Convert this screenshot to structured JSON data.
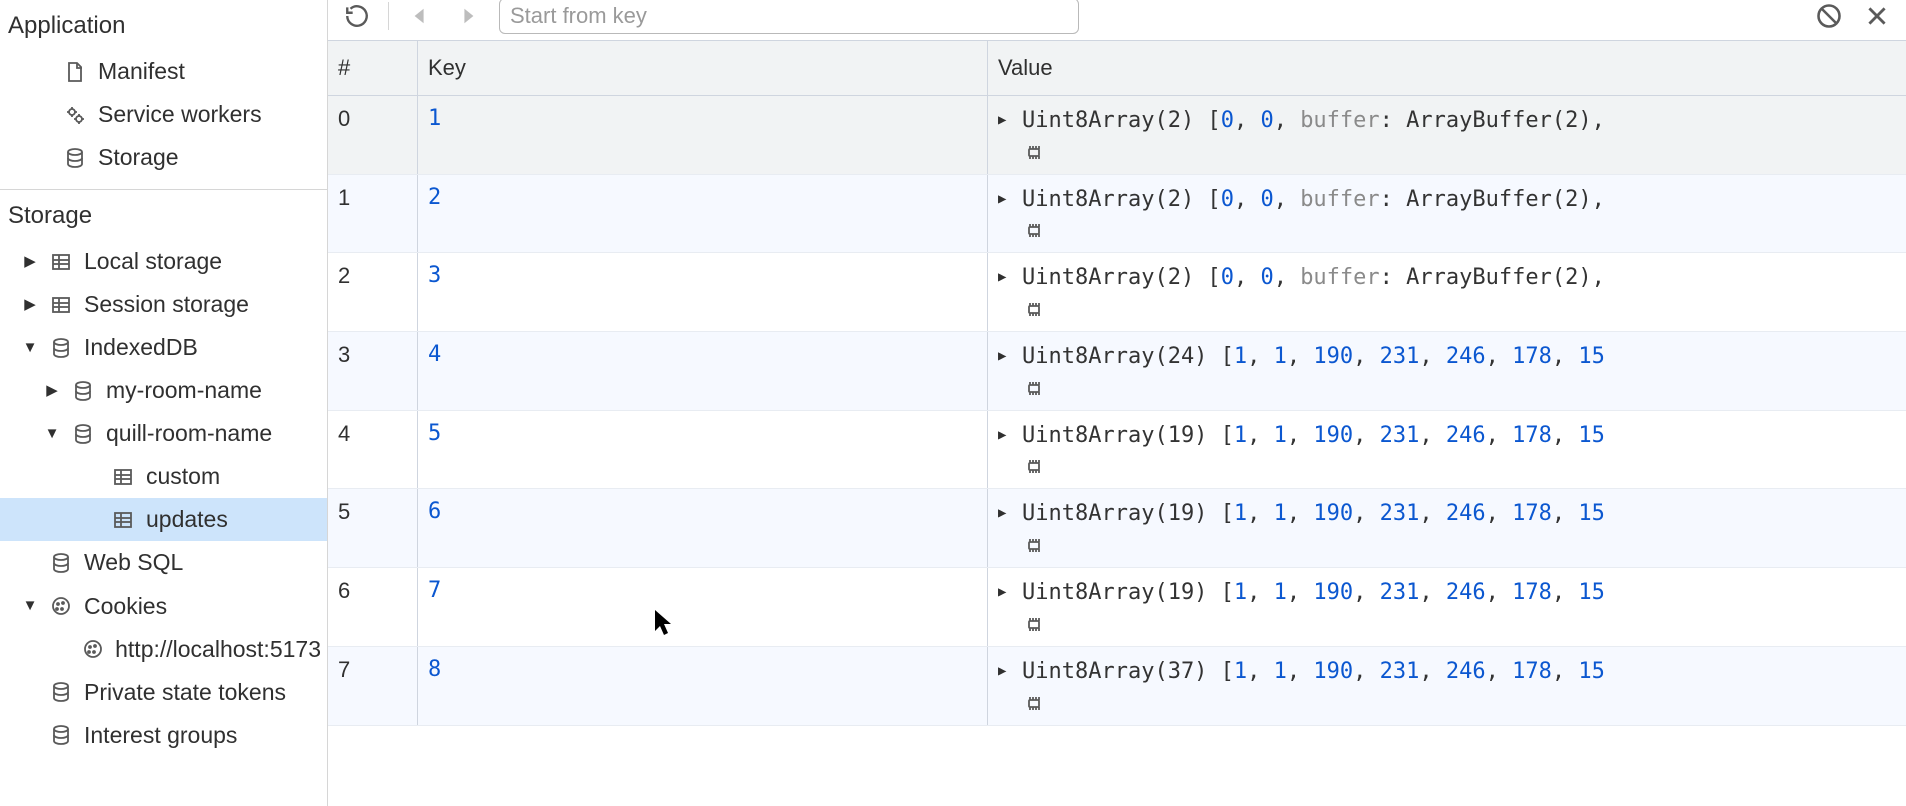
{
  "search": {
    "placeholder": "Start from key",
    "value": ""
  },
  "sidebar": {
    "section_application": "Application",
    "section_storage": "Storage",
    "items_app": [
      {
        "label": "Manifest",
        "icon": "file"
      },
      {
        "label": "Service workers",
        "icon": "gears"
      },
      {
        "label": "Storage",
        "icon": "db"
      }
    ],
    "items_storage": [
      {
        "label": "Local storage",
        "icon": "table",
        "expand": "right",
        "indent": 1
      },
      {
        "label": "Session storage",
        "icon": "table",
        "expand": "right",
        "indent": 1
      },
      {
        "label": "IndexedDB",
        "icon": "db",
        "expand": "down",
        "indent": 1
      },
      {
        "label": "my-room-name",
        "icon": "db",
        "expand": "right",
        "indent": 2
      },
      {
        "label": "quill-room-name",
        "icon": "db",
        "expand": "down",
        "indent": 2
      },
      {
        "label": "custom",
        "icon": "table",
        "expand": "none",
        "indent": 4
      },
      {
        "label": "updates",
        "icon": "table",
        "expand": "none",
        "indent": 4,
        "selected": true
      },
      {
        "label": "Web SQL",
        "icon": "db",
        "expand": "none",
        "indent": 1
      },
      {
        "label": "Cookies",
        "icon": "cookie",
        "expand": "down",
        "indent": 1
      },
      {
        "label": "http://localhost:5173",
        "icon": "cookie",
        "expand": "none",
        "indent": 3
      },
      {
        "label": "Private state tokens",
        "icon": "db",
        "expand": "none",
        "indent": 1
      },
      {
        "label": "Interest groups",
        "icon": "db",
        "expand": "none",
        "indent": 1
      }
    ]
  },
  "table": {
    "headers": {
      "idx": "#",
      "key": "Key",
      "value": "Value"
    },
    "rows": [
      {
        "idx": "0",
        "key": "1",
        "selected": true,
        "value": {
          "type": "Uint8Array",
          "len": 2,
          "preview": [
            0,
            0
          ],
          "tail": "buffer: ArrayBuffer(2),",
          "tailIsDim": true
        }
      },
      {
        "idx": "1",
        "key": "2",
        "value": {
          "type": "Uint8Array",
          "len": 2,
          "preview": [
            0,
            0
          ],
          "tail": "buffer: ArrayBuffer(2),",
          "tailIsDim": true
        }
      },
      {
        "idx": "2",
        "key": "3",
        "value": {
          "type": "Uint8Array",
          "len": 2,
          "preview": [
            0,
            0
          ],
          "tail": "buffer: ArrayBuffer(2),",
          "tailIsDim": true
        }
      },
      {
        "idx": "3",
        "key": "4",
        "value": {
          "type": "Uint8Array",
          "len": 24,
          "preview": [
            1,
            1,
            190,
            231,
            246,
            178,
            15
          ],
          "tailIsDim": false
        }
      },
      {
        "idx": "4",
        "key": "5",
        "value": {
          "type": "Uint8Array",
          "len": 19,
          "preview": [
            1,
            1,
            190,
            231,
            246,
            178,
            15
          ],
          "tailIsDim": false
        }
      },
      {
        "idx": "5",
        "key": "6",
        "value": {
          "type": "Uint8Array",
          "len": 19,
          "preview": [
            1,
            1,
            190,
            231,
            246,
            178,
            15
          ],
          "tailIsDim": false
        }
      },
      {
        "idx": "6",
        "key": "7",
        "value": {
          "type": "Uint8Array",
          "len": 19,
          "preview": [
            1,
            1,
            190,
            231,
            246,
            178,
            15
          ],
          "tailIsDim": false
        }
      },
      {
        "idx": "7",
        "key": "8",
        "value": {
          "type": "Uint8Array",
          "len": 37,
          "preview": [
            1,
            1,
            190,
            231,
            246,
            178,
            15
          ],
          "tailIsDim": false
        }
      }
    ]
  }
}
